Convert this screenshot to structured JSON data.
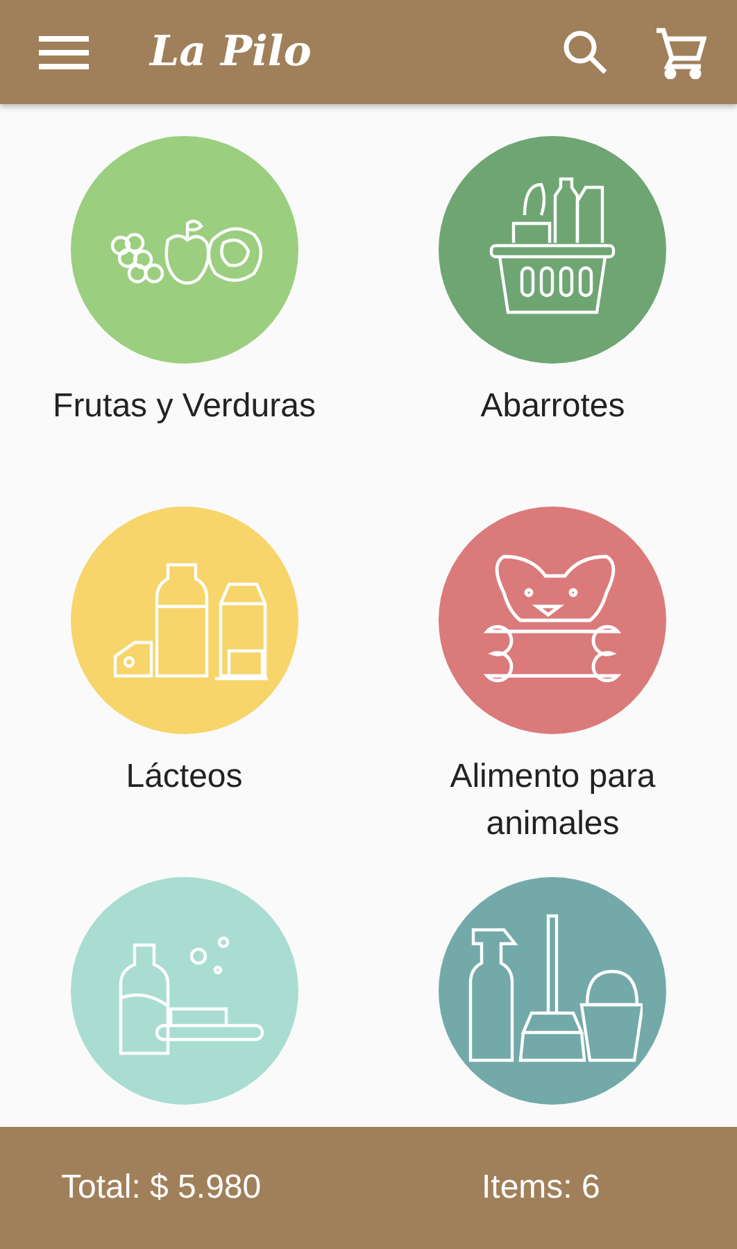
{
  "app_bar": {
    "title": "La Pilo"
  },
  "categories": [
    {
      "label": "Frutas y Verduras",
      "kind": "produce",
      "color": "#9bcf7f"
    },
    {
      "label": "Abarrotes",
      "kind": "groceries",
      "color": "#6ea573"
    },
    {
      "label": "Lácteos",
      "kind": "dairy",
      "color": "#f7d56b"
    },
    {
      "label": "Alimento para animales",
      "kind": "pets",
      "color": "#db7a7a"
    },
    {
      "kind": "hygiene",
      "color": "#a9ddd1"
    },
    {
      "kind": "cleaning",
      "color": "#74a9aa"
    }
  ],
  "footer": {
    "total": "Total: $ 5.980",
    "items": "Items: 6"
  }
}
